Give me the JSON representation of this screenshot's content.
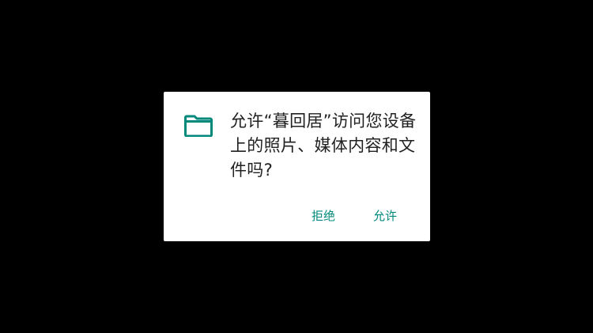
{
  "dialog": {
    "message": "允许“暮回居”访问您设备上的照片、媒体内容和文件吗?",
    "icon": "folder-icon",
    "deny_label": "拒绝",
    "allow_label": "允许"
  },
  "colors": {
    "background": "#000000",
    "dialog_bg": "#ffffff",
    "accent": "#00897b",
    "text": "#212121"
  }
}
